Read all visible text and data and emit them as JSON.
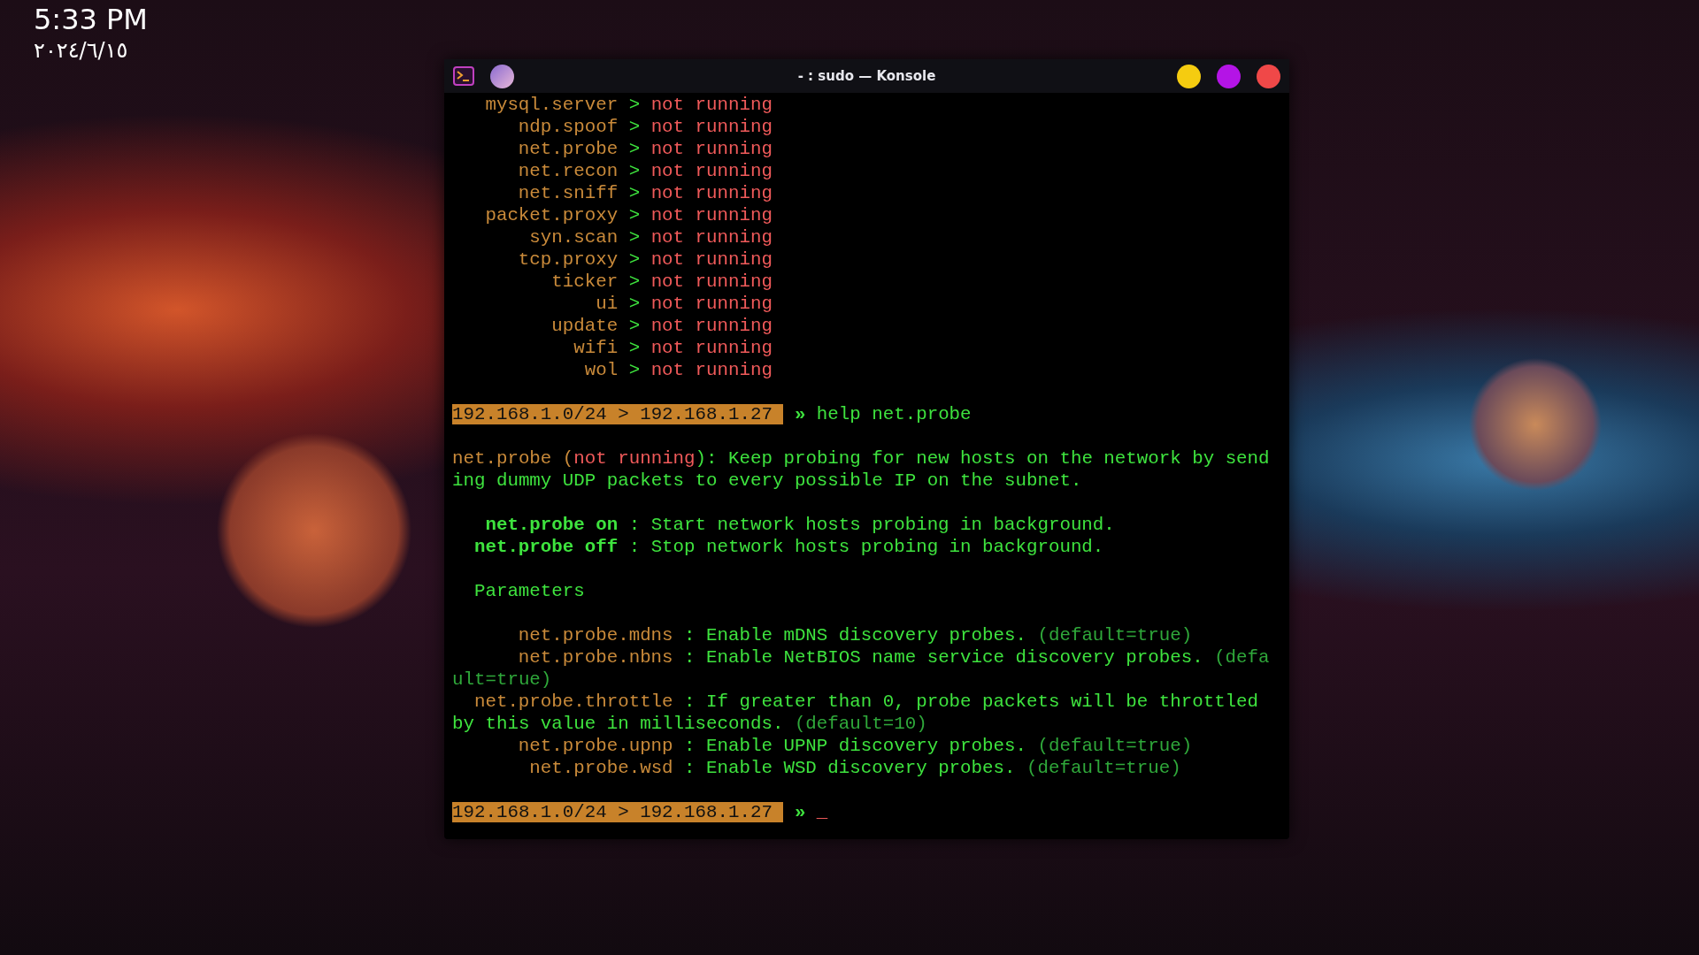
{
  "clock": {
    "time": "5:33 PM",
    "date": "٢٠٢٤/٦/١٥"
  },
  "window": {
    "title": "- : sudo — Konsole"
  },
  "terminal": {
    "lines": [
      {
        "kind": "module",
        "name": "mysql.server",
        "separator": ">",
        "status": "not running"
      },
      {
        "kind": "module",
        "name": "ndp.spoof",
        "separator": ">",
        "status": "not running"
      },
      {
        "kind": "module",
        "name": "net.probe",
        "separator": ">",
        "status": "not running"
      },
      {
        "kind": "module",
        "name": "net.recon",
        "separator": ">",
        "status": "not running"
      },
      {
        "kind": "module",
        "name": "net.sniff",
        "separator": ">",
        "status": "not running"
      },
      {
        "kind": "module",
        "name": "packet.proxy",
        "separator": ">",
        "status": "not running"
      },
      {
        "kind": "module",
        "name": "syn.scan",
        "separator": ">",
        "status": "not running"
      },
      {
        "kind": "module",
        "name": "tcp.proxy",
        "separator": ">",
        "status": "not running"
      },
      {
        "kind": "module",
        "name": "ticker",
        "separator": ">",
        "status": "not running"
      },
      {
        "kind": "module",
        "name": "ui",
        "separator": ">",
        "status": "not running"
      },
      {
        "kind": "module",
        "name": "update",
        "separator": ">",
        "status": "not running"
      },
      {
        "kind": "module",
        "name": "wifi",
        "separator": ">",
        "status": "not running"
      },
      {
        "kind": "module",
        "name": "wol",
        "separator": ">",
        "status": "not running"
      },
      {
        "kind": "blank"
      },
      {
        "kind": "prompt",
        "network": "192.168.1.0/24 > 192.168.1.27",
        "symbol": "»",
        "command": "help net.probe"
      },
      {
        "kind": "blank"
      },
      {
        "kind": "segments",
        "segments": [
          {
            "kind": "module",
            "text": "net.probe ("
          },
          {
            "kind": "status",
            "text": "not running"
          },
          {
            "kind": "text",
            "text": "): Keep probing for new hosts on the network by sending dummy UDP packets to every possible IP on the subnet."
          }
        ]
      },
      {
        "kind": "blank"
      },
      {
        "kind": "command",
        "name": "net.probe on",
        "separator": ":",
        "description": "Start network hosts probing in background."
      },
      {
        "kind": "command",
        "name": "net.probe off",
        "separator": ":",
        "description": "Stop network hosts probing in background."
      },
      {
        "kind": "blank"
      },
      {
        "kind": "heading",
        "text": "Parameters"
      },
      {
        "kind": "blank"
      },
      {
        "kind": "param",
        "name": "net.probe.mdns",
        "separator": ":",
        "description": "Enable mDNS discovery probes.",
        "default": "(default=true)"
      },
      {
        "kind": "param",
        "name": "net.probe.nbns",
        "separator": ":",
        "description": "Enable NetBIOS name service discovery probes.",
        "default": "(default=true)"
      },
      {
        "kind": "param",
        "name": "net.probe.throttle",
        "separator": ":",
        "description": "If greater than 0, probe packets will be throttled by this value in milliseconds.",
        "default": "(default=10)"
      },
      {
        "kind": "param",
        "name": "net.probe.upnp",
        "separator": ":",
        "description": "Enable UPNP discovery probes.",
        "default": "(default=true)"
      },
      {
        "kind": "param",
        "name": "net.probe.wsd",
        "separator": ":",
        "description": "Enable WSD discovery probes.",
        "default": "(default=true)"
      },
      {
        "kind": "blank"
      },
      {
        "kind": "prompt",
        "network": "192.168.1.0/24 > 192.168.1.27",
        "symbol": "»",
        "cursor": "_"
      }
    ]
  }
}
